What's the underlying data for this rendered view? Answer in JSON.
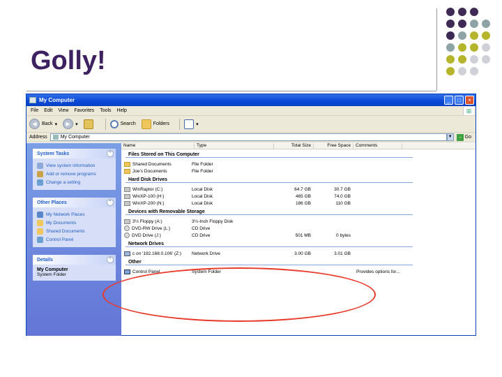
{
  "slide": {
    "title": "Golly!"
  },
  "dot_colors": [
    "#3f2a56",
    "#8ea3a5",
    "#b5b52b",
    "#d0d0d8"
  ],
  "window": {
    "title": "My Computer",
    "menu": [
      "File",
      "Edit",
      "View",
      "Favorites",
      "Tools",
      "Help"
    ],
    "toolbar": {
      "back": "Back",
      "search": "Search",
      "folders": "Folders"
    },
    "address_label": "Address",
    "address_value": "My Computer",
    "go_label": "Go"
  },
  "columns": [
    "Name",
    "Type",
    "Total Size",
    "Free Space",
    "Comments"
  ],
  "taskpane": {
    "system_tasks": {
      "title": "System Tasks",
      "items": [
        "View system information",
        "Add or remove programs",
        "Change a setting"
      ]
    },
    "other_places": {
      "title": "Other Places",
      "items": [
        "My Network Places",
        "My Documents",
        "Shared Documents",
        "Control Panel"
      ]
    },
    "details": {
      "title": "Details",
      "name": "My Computer",
      "type": "System Folder"
    }
  },
  "groups": {
    "files": {
      "title": "Files Stored on This Computer",
      "rows": [
        {
          "name": "Shared Documents",
          "type": "File Folder",
          "size": "",
          "free": "",
          "comments": ""
        },
        {
          "name": "Joe's Documents",
          "type": "File Folder",
          "size": "",
          "free": "",
          "comments": ""
        }
      ]
    },
    "hdd": {
      "title": "Hard Disk Drives",
      "rows": [
        {
          "name": "WinRaptor (C:)",
          "type": "Local Disk",
          "size": "64.7 GB",
          "free": "30.7 GB",
          "comments": ""
        },
        {
          "name": "WinXP-100 (H:)",
          "type": "Local Disk",
          "size": "465 GB",
          "free": "74.0 GB",
          "comments": ""
        },
        {
          "name": "WinXP-200 (N:)",
          "type": "Local Disk",
          "size": "186 GB",
          "free": "110 GB",
          "comments": ""
        }
      ]
    },
    "removable": {
      "title": "Devices with Removable Storage",
      "rows": [
        {
          "name": "3½ Floppy (A:)",
          "type": "3½-Inch Floppy Disk",
          "size": "",
          "free": "",
          "comments": ""
        },
        {
          "name": "DVD-RW Drive (L:)",
          "type": "CD Drive",
          "size": "",
          "free": "",
          "comments": ""
        },
        {
          "name": "DVD Drive (J:)",
          "type": "CD Drive",
          "size": "501 MB",
          "free": "0 bytes",
          "comments": ""
        }
      ]
    },
    "network": {
      "title": "Network Drives",
      "rows": [
        {
          "name": "c on '192.168.0.106' (Z:)",
          "type": "Network Drive",
          "size": "3.00 GB",
          "free": "3.01 GB",
          "comments": ""
        }
      ]
    },
    "other": {
      "title": "Other",
      "rows": [
        {
          "name": "Control Panel",
          "type": "System Folder",
          "size": "",
          "free": "",
          "comments": "Provides options for..."
        }
      ]
    }
  }
}
